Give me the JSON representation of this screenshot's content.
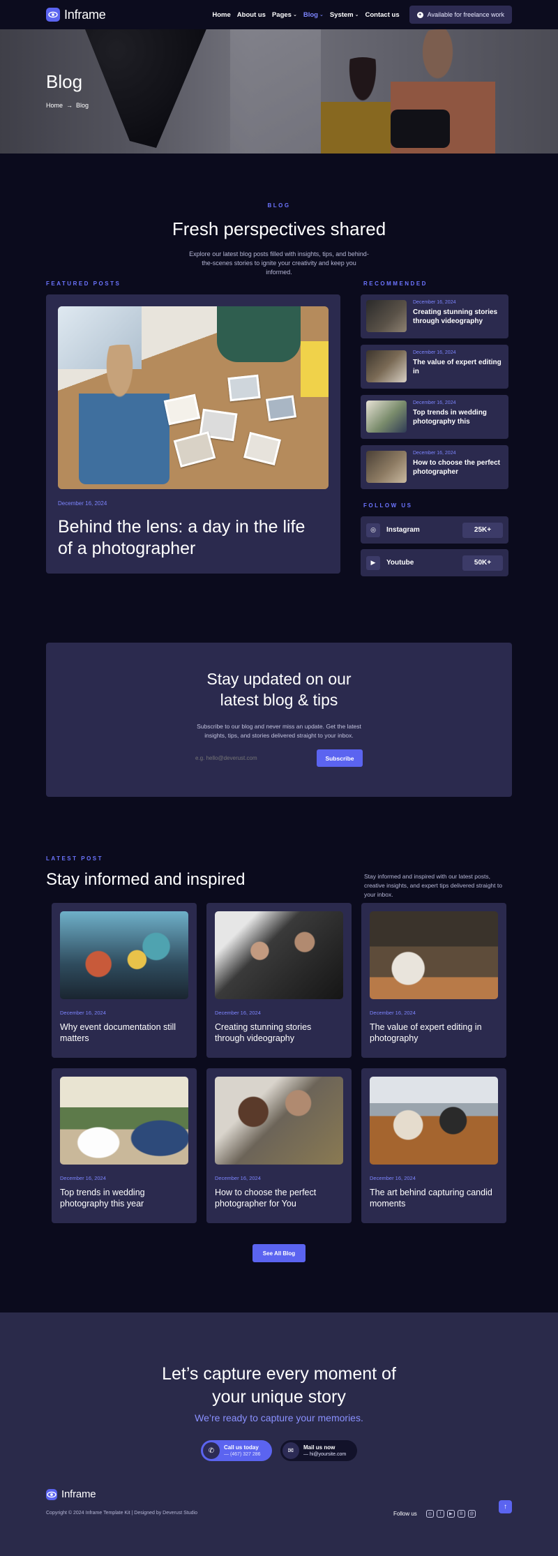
{
  "nav": {
    "logo_text": "Inframe",
    "items": [
      {
        "label": "Home",
        "caret": false
      },
      {
        "label": "About us",
        "caret": false
      },
      {
        "label": "Pages",
        "caret": true
      },
      {
        "label": "Blog",
        "caret": true,
        "active": true
      },
      {
        "label": "System",
        "caret": true
      },
      {
        "label": "Contact us",
        "caret": false
      }
    ],
    "cta_label": "Available for freelance work",
    "accent_color": "#5b64f0"
  },
  "hero": {
    "title": "Blog",
    "breadcrumb_home": "Home",
    "breadcrumb_sep": "→",
    "breadcrumb_current": "Blog"
  },
  "intro": {
    "eyebrow": "BLOG",
    "title": "Fresh perspectives shared",
    "description": "Explore our latest blog posts filled with insights, tips, and behind-the-scenes stories to ignite your creativity and keep you informed."
  },
  "featured": {
    "label": "FEATURED POSTS",
    "date": "December 16, 2024",
    "title": "Behind the lens: a day in the life of a photographer"
  },
  "recommended": {
    "label": "RECOMMENDED",
    "items": [
      {
        "date": "December 16, 2024",
        "title": "Creating stunning stories through videography"
      },
      {
        "date": "December 16, 2024",
        "title": "The value of expert editing in"
      },
      {
        "date": "December 16, 2024",
        "title": "Top trends in wedding photography this"
      },
      {
        "date": "December 16, 2024",
        "title": "How to choose the perfect photographer"
      }
    ]
  },
  "follow": {
    "label": "FOLLOW US",
    "socials": [
      {
        "name": "Instagram",
        "count": "25K+",
        "icon": "instagram-icon"
      },
      {
        "name": "Youtube",
        "count": "50K+",
        "icon": "youtube-icon"
      }
    ]
  },
  "newsletter": {
    "title": "Stay updated on our latest blog & tips",
    "description": "Subscribe to our blog and never miss an update. Get the latest insights, tips, and stories delivered straight to your inbox.",
    "placeholder": "e.g. hello@deverust.com",
    "button": "Subscribe"
  },
  "latest": {
    "label": "LATEST POST",
    "title": "Stay informed and inspired",
    "description": "Stay informed and inspired with our latest posts, creative insights, and expert tips delivered straight to your inbox.",
    "posts": [
      {
        "date": "December 16, 2024",
        "title": "Why event documentation still matters"
      },
      {
        "date": "December 16, 2024",
        "title": "Creating stunning stories through videography"
      },
      {
        "date": "December 16, 2024",
        "title": "The value of expert editing in photography"
      },
      {
        "date": "December 16, 2024",
        "title": "Top trends in wedding photography this year"
      },
      {
        "date": "December 16, 2024",
        "title": "How to choose the perfect photographer for You"
      },
      {
        "date": "December 16, 2024",
        "title": "The art behind capturing candid moments"
      }
    ],
    "see_all": "See All Blog"
  },
  "capture": {
    "title": "Let’s capture every moment of your unique story",
    "subtitle": "We’re ready to capture your memories.",
    "call_label": "Call us today",
    "call_value": "— (467) 327 286",
    "mail_label": "Mail us now",
    "mail_value": "— hi@yoursite.com"
  },
  "footer": {
    "logo_text": "Inframe",
    "copyright": "Copyright © 2024 Inframe Template Kit | Designed by Deverust Studio",
    "follow_label": "Follow us",
    "icons": [
      "instagram-icon",
      "facebook-icon",
      "youtube-icon",
      "behance-icon",
      "threads-icon"
    ],
    "to_top": "↑"
  }
}
